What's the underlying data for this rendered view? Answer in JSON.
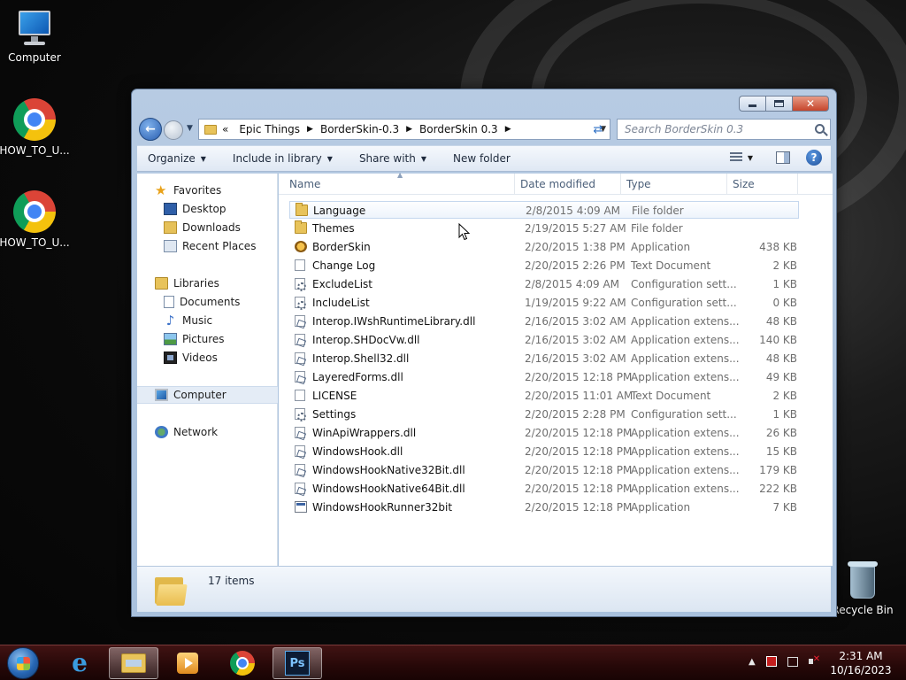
{
  "desktop": {
    "icons": [
      {
        "label": "Computer"
      },
      {
        "label": "HOW_TO_U..."
      },
      {
        "label": "HOW_TO_U..."
      },
      {
        "label": "Recycle Bin"
      }
    ]
  },
  "window": {
    "address": {
      "overflow": "«",
      "crumbs": [
        "Epic Things",
        "BorderSkin-0.3",
        "BorderSkin 0.3"
      ]
    },
    "search_placeholder": "Search BorderSkin 0.3",
    "toolbar": {
      "organize": "Organize",
      "include_in_library": "Include in library",
      "share_with": "Share with",
      "new_folder": "New folder"
    },
    "nav": {
      "favorites": "Favorites",
      "desktop": "Desktop",
      "downloads": "Downloads",
      "recent_places": "Recent Places",
      "libraries": "Libraries",
      "documents": "Documents",
      "music": "Music",
      "pictures": "Pictures",
      "videos": "Videos",
      "computer": "Computer",
      "network": "Network"
    },
    "columns": {
      "name": "Name",
      "date": "Date modified",
      "type": "Type",
      "size": "Size"
    },
    "files": [
      {
        "name": "Language",
        "date": "2/8/2015 4:09 AM",
        "type": "File folder",
        "size": "",
        "icon": "folder"
      },
      {
        "name": "Themes",
        "date": "2/19/2015 5:27 AM",
        "type": "File folder",
        "size": "",
        "icon": "folder"
      },
      {
        "name": "BorderSkin",
        "date": "2/20/2015 1:38 PM",
        "type": "Application",
        "size": "438 KB",
        "icon": "app"
      },
      {
        "name": "Change Log",
        "date": "2/20/2015 2:26 PM",
        "type": "Text Document",
        "size": "2 KB",
        "icon": "text"
      },
      {
        "name": "ExcludeList",
        "date": "2/8/2015 4:09 AM",
        "type": "Configuration sett...",
        "size": "1 KB",
        "icon": "config"
      },
      {
        "name": "IncludeList",
        "date": "1/19/2015 9:22 AM",
        "type": "Configuration sett...",
        "size": "0 KB",
        "icon": "config"
      },
      {
        "name": "Interop.IWshRuntimeLibrary.dll",
        "date": "2/16/2015 3:02 AM",
        "type": "Application extens...",
        "size": "48 KB",
        "icon": "dll"
      },
      {
        "name": "Interop.SHDocVw.dll",
        "date": "2/16/2015 3:02 AM",
        "type": "Application extens...",
        "size": "140 KB",
        "icon": "dll"
      },
      {
        "name": "Interop.Shell32.dll",
        "date": "2/16/2015 3:02 AM",
        "type": "Application extens...",
        "size": "48 KB",
        "icon": "dll"
      },
      {
        "name": "LayeredForms.dll",
        "date": "2/20/2015 12:18 PM",
        "type": "Application extens...",
        "size": "49 KB",
        "icon": "dll"
      },
      {
        "name": "LICENSE",
        "date": "2/20/2015 11:01 AM",
        "type": "Text Document",
        "size": "2 KB",
        "icon": "text"
      },
      {
        "name": "Settings",
        "date": "2/20/2015 2:28 PM",
        "type": "Configuration sett...",
        "size": "1 KB",
        "icon": "config"
      },
      {
        "name": "WinApiWrappers.dll",
        "date": "2/20/2015 12:18 PM",
        "type": "Application extens...",
        "size": "26 KB",
        "icon": "dll"
      },
      {
        "name": "WindowsHook.dll",
        "date": "2/20/2015 12:18 PM",
        "type": "Application extens...",
        "size": "15 KB",
        "icon": "dll"
      },
      {
        "name": "WindowsHookNative32Bit.dll",
        "date": "2/20/2015 12:18 PM",
        "type": "Application extens...",
        "size": "179 KB",
        "icon": "dll"
      },
      {
        "name": "WindowsHookNative64Bit.dll",
        "date": "2/20/2015 12:18 PM",
        "type": "Application extens...",
        "size": "222 KB",
        "icon": "dll"
      },
      {
        "name": "WindowsHookRunner32bit",
        "date": "2/20/2015 12:18 PM",
        "type": "Application",
        "size": "7 KB",
        "icon": "exe"
      }
    ],
    "status": "17 items"
  },
  "taskbar": {
    "clock_time": "2:31 AM",
    "clock_date": "10/16/2023",
    "photoshop_label": "Ps"
  }
}
